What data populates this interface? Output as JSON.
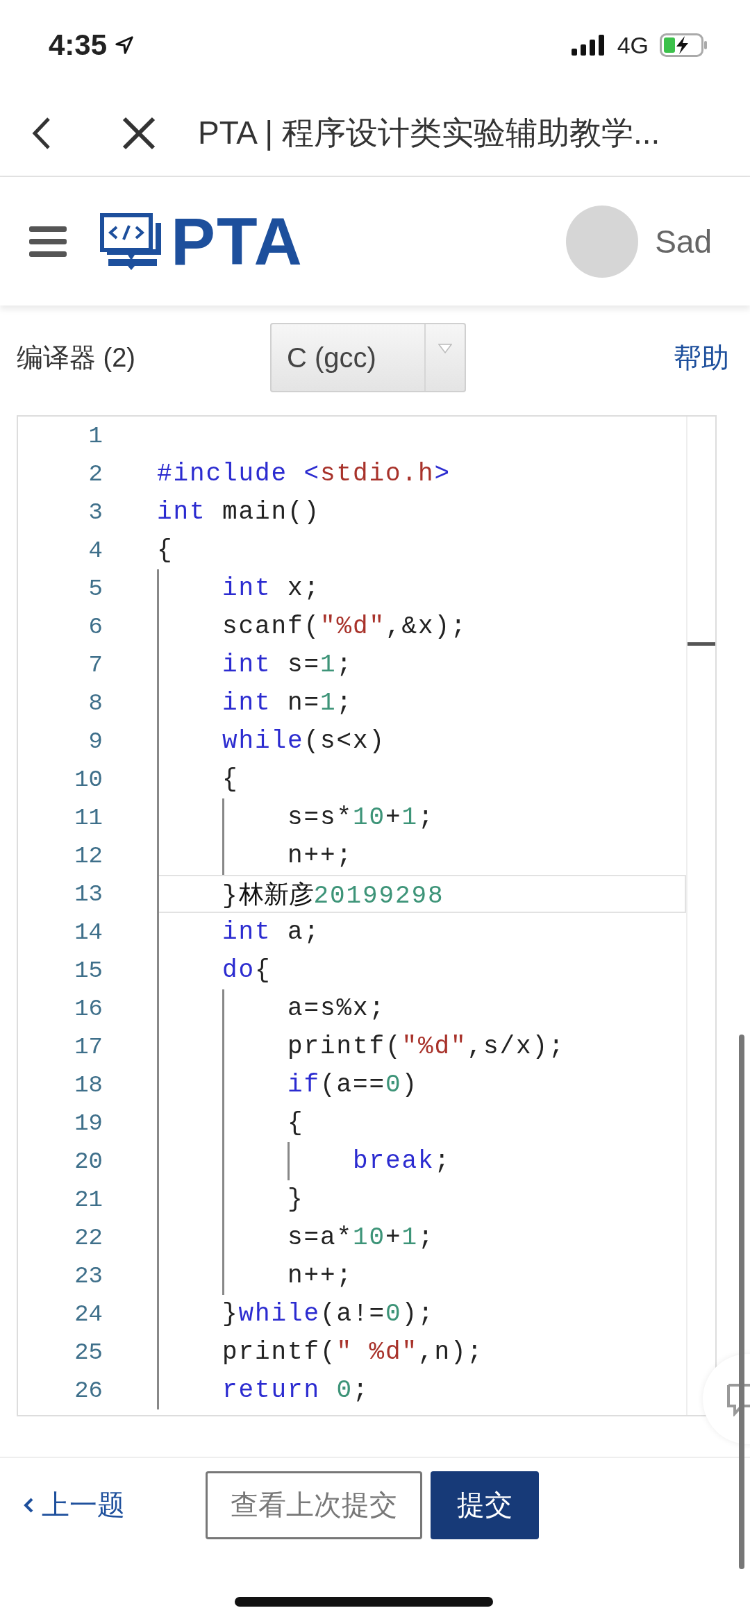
{
  "status_bar": {
    "time": "4:35",
    "network": "4G"
  },
  "nav_bar": {
    "title": "PTA | 程序设计类实验辅助教学..."
  },
  "header": {
    "logo_text": "PTA",
    "user_name": "Sad"
  },
  "toolbar": {
    "compiler_label": "编译器 (2)",
    "compiler_select": "C (gcc)",
    "help_link": "帮助"
  },
  "editor": {
    "lines": [
      {
        "number": "1",
        "active": false
      },
      {
        "number": "2",
        "active": false,
        "tokens": [
          {
            "kind": "keyword",
            "text": "#include "
          },
          {
            "kind": "keyword",
            "text": "<"
          },
          {
            "kind": "string",
            "text": "stdio.h"
          },
          {
            "kind": "keyword",
            "text": ">"
          }
        ]
      },
      {
        "number": "3",
        "active": false,
        "tokens": [
          {
            "kind": "keyword",
            "text": "int"
          },
          {
            "kind": "plain",
            "text": " main()"
          }
        ]
      },
      {
        "number": "4",
        "active": false,
        "tokens": [
          {
            "kind": "plain",
            "text": "{"
          }
        ]
      },
      {
        "number": "5",
        "active": false,
        "tokens": [
          {
            "kind": "keyword",
            "text": "    int"
          },
          {
            "kind": "plain",
            "text": " x;"
          }
        ]
      },
      {
        "number": "6",
        "active": false,
        "tokens": [
          {
            "kind": "plain",
            "text": "    scanf("
          },
          {
            "kind": "string",
            "text": "\"%d\""
          },
          {
            "kind": "plain",
            "text": ",&x);"
          }
        ]
      },
      {
        "number": "7",
        "active": false,
        "tokens": [
          {
            "kind": "keyword",
            "text": "    int"
          },
          {
            "kind": "plain",
            "text": " s="
          },
          {
            "kind": "number",
            "text": "1"
          },
          {
            "kind": "plain",
            "text": ";"
          }
        ]
      },
      {
        "number": "8",
        "active": false,
        "tokens": [
          {
            "kind": "keyword",
            "text": "    int"
          },
          {
            "kind": "plain",
            "text": " n="
          },
          {
            "kind": "number",
            "text": "1"
          },
          {
            "kind": "plain",
            "text": ";"
          }
        ]
      },
      {
        "number": "9",
        "active": false,
        "tokens": [
          {
            "kind": "keyword",
            "text": "    while"
          },
          {
            "kind": "plain",
            "text": "(s<x)"
          }
        ]
      },
      {
        "number": "10",
        "active": false,
        "tokens": [
          {
            "kind": "plain",
            "text": "    {"
          }
        ]
      },
      {
        "number": "11",
        "active": false,
        "tokens": [
          {
            "kind": "plain",
            "text": "        s=s*"
          },
          {
            "kind": "number",
            "text": "10"
          },
          {
            "kind": "plain",
            "text": "+"
          },
          {
            "kind": "number",
            "text": "1"
          },
          {
            "kind": "plain",
            "text": ";"
          }
        ]
      },
      {
        "number": "12",
        "active": false,
        "tokens": [
          {
            "kind": "plain",
            "text": "        n++;"
          }
        ]
      },
      {
        "number": "13",
        "active": true,
        "tokens": [
          {
            "kind": "plain",
            "text": "    }"
          },
          {
            "kind": "cjk",
            "text": "林新彦"
          },
          {
            "kind": "number",
            "text": "20199298"
          }
        ]
      },
      {
        "number": "14",
        "active": false,
        "tokens": [
          {
            "kind": "keyword",
            "text": "    int"
          },
          {
            "kind": "plain",
            "text": " a;"
          }
        ]
      },
      {
        "number": "15",
        "active": false,
        "tokens": [
          {
            "kind": "keyword",
            "text": "    do"
          },
          {
            "kind": "plain",
            "text": "{"
          }
        ]
      },
      {
        "number": "16",
        "active": false,
        "tokens": [
          {
            "kind": "plain",
            "text": "        a=s%x;"
          }
        ]
      },
      {
        "number": "17",
        "active": false,
        "tokens": [
          {
            "kind": "plain",
            "text": "        printf("
          },
          {
            "kind": "string",
            "text": "\"%d\""
          },
          {
            "kind": "plain",
            "text": ",s/x);"
          }
        ]
      },
      {
        "number": "18",
        "active": false,
        "tokens": [
          {
            "kind": "keyword",
            "text": "        if"
          },
          {
            "kind": "plain",
            "text": "(a=="
          },
          {
            "kind": "number",
            "text": "0"
          },
          {
            "kind": "plain",
            "text": ")"
          }
        ]
      },
      {
        "number": "19",
        "active": false,
        "tokens": [
          {
            "kind": "plain",
            "text": "        {"
          }
        ]
      },
      {
        "number": "20",
        "active": false,
        "tokens": [
          {
            "kind": "keyword",
            "text": "            break"
          },
          {
            "kind": "plain",
            "text": ";"
          }
        ]
      },
      {
        "number": "21",
        "active": false,
        "tokens": [
          {
            "kind": "plain",
            "text": "        }"
          }
        ]
      },
      {
        "number": "22",
        "active": false,
        "tokens": [
          {
            "kind": "plain",
            "text": "        s=a*"
          },
          {
            "kind": "number",
            "text": "10"
          },
          {
            "kind": "plain",
            "text": "+"
          },
          {
            "kind": "number",
            "text": "1"
          },
          {
            "kind": "plain",
            "text": ";"
          }
        ]
      },
      {
        "number": "23",
        "active": false,
        "tokens": [
          {
            "kind": "plain",
            "text": "        n++;"
          }
        ]
      },
      {
        "number": "24",
        "active": false,
        "tokens": [
          {
            "kind": "plain",
            "text": "    }"
          },
          {
            "kind": "keyword",
            "text": "while"
          },
          {
            "kind": "plain",
            "text": "(a!="
          },
          {
            "kind": "number",
            "text": "0"
          },
          {
            "kind": "plain",
            "text": ");"
          }
        ]
      },
      {
        "number": "25",
        "active": false,
        "tokens": [
          {
            "kind": "plain",
            "text": "    printf("
          },
          {
            "kind": "string",
            "text": "\" %d\""
          },
          {
            "kind": "plain",
            "text": ",n);"
          }
        ]
      },
      {
        "number": "26",
        "active": false,
        "tokens": [
          {
            "kind": "keyword",
            "text": "    return"
          },
          {
            "kind": "number",
            "text": " 0"
          },
          {
            "kind": "plain",
            "text": ";"
          }
        ]
      }
    ]
  },
  "footer": {
    "prev_link": "上一题",
    "view_last_button": "查看上次提交",
    "submit_button": "提交"
  }
}
